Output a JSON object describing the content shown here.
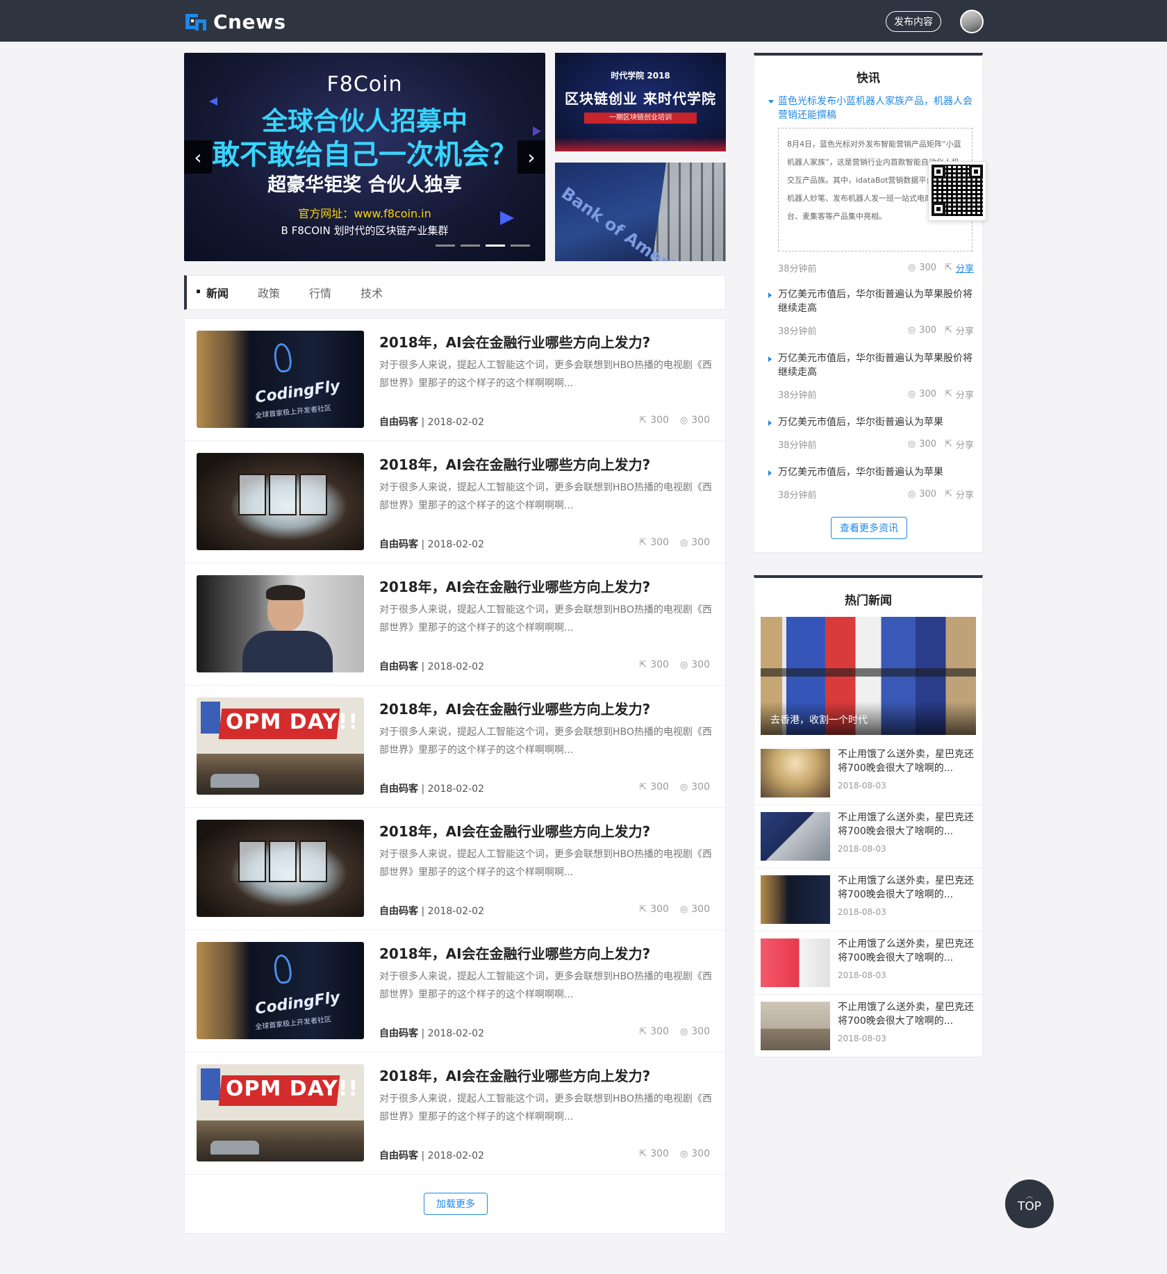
{
  "header": {
    "logo_text": "Cnews",
    "publish_label": "发布内容"
  },
  "banner": {
    "main": {
      "line1": "F8Coin",
      "line2": "全球合伙人招募中",
      "line3": "敢不敢给自己一次机会？",
      "line4": "超豪华钜奖   合伙人独享",
      "line5": "官方网址：www.f8coin.in",
      "line6": "B F8COIN 划时代的区块链产业集群",
      "prev": "‹",
      "next": "›",
      "dots": 4,
      "active_dot": 3
    },
    "side1": {
      "top": "时代学院 2018",
      "title": "区块链创业  来时代学院",
      "tag": "一期区块链创业培训"
    },
    "side2": {
      "sign": "Bank of America"
    }
  },
  "tabs": [
    "新闻",
    "政策",
    "行情",
    "技术"
  ],
  "news": [
    {
      "title": "2018年，AI会在金融行业哪些方向上发力?",
      "desc": "对于很多人来说，提起人工智能这个词，更多会联想到HBO热播的电视剧《西部世界》里那子的这个样子的这个样啊啊啊...",
      "author": "自由码客",
      "date": "2018-02-02",
      "shares": "300",
      "views": "300",
      "thumb": "coding",
      "thumb_text": "CodingFly",
      "thumb_sub": "全球首家极上开发者社区"
    },
    {
      "title": "2018年，AI会在金融行业哪些方向上发力?",
      "desc": "对于很多人来说，提起人工智能这个词，更多会联想到HBO热播的电视剧《西部世界》里那子的这个样子的这个样啊啊啊...",
      "author": "自由码客",
      "date": "2018-02-02",
      "shares": "300",
      "views": "300",
      "thumb": "office"
    },
    {
      "title": "2018年，AI会在金融行业哪些方向上发力?",
      "desc": "对于很多人来说，提起人工智能这个词，更多会联想到HBO热播的电视剧《西部世界》里那子的这个样子的这个样啊啊啊...",
      "author": "自由码客",
      "date": "2018-02-02",
      "shares": "300",
      "views": "300",
      "thumb": "person"
    },
    {
      "title": "2018年，AI会在金融行业哪些方向上发力?",
      "desc": "对于很多人来说，提起人工智能这个词，更多会联想到HBO热播的电视剧《西部世界》里那子的这个样子的这个样啊啊啊...",
      "author": "自由码客",
      "date": "2018-02-02",
      "shares": "300",
      "views": "300",
      "thumb": "opm",
      "thumb_text": "OPM DAY!!"
    },
    {
      "title": "2018年，AI会在金融行业哪些方向上发力?",
      "desc": "对于很多人来说，提起人工智能这个词，更多会联想到HBO热播的电视剧《西部世界》里那子的这个样子的这个样啊啊啊...",
      "author": "自由码客",
      "date": "2018-02-02",
      "shares": "300",
      "views": "300",
      "thumb": "office"
    },
    {
      "title": "2018年，AI会在金融行业哪些方向上发力?",
      "desc": "对于很多人来说，提起人工智能这个词，更多会联想到HBO热播的电视剧《西部世界》里那子的这个样子的这个样啊啊啊...",
      "author": "自由码客",
      "date": "2018-02-02",
      "shares": "300",
      "views": "300",
      "thumb": "coding",
      "thumb_text": "CodingFly",
      "thumb_sub": "全球首家极上开发者社区"
    },
    {
      "title": "2018年，AI会在金融行业哪些方向上发力?",
      "desc": "对于很多人来说，提起人工智能这个词，更多会联想到HBO热播的电视剧《西部世界》里那子的这个样子的这个样啊啊啊...",
      "author": "自由码客",
      "date": "2018-02-02",
      "shares": "300",
      "views": "300",
      "thumb": "opm",
      "thumb_text": "OPM DAY!!"
    }
  ],
  "load_more": "加载更多",
  "flash": {
    "title": "快讯",
    "items": [
      {
        "title": "蓝色光标发布小蓝机器人家族产品，机器人会营销还能撰稿",
        "open": true,
        "detail": "8月4日，蓝色光标对外发布智能营销产品矩阵“小蓝机器人家族”，这是营销行业内首款智能自动化人机交互产品族。其中，idataBot营销数据平台、撰稿机器人妙笔、发布机器人发一班一站式电商营销平台、麦集客等产品集中亮相。",
        "time": "38分钟前",
        "views": "300",
        "share": "分享"
      },
      {
        "title": "万亿美元市值后，华尔街普遍认为苹果股价将继续走高",
        "time": "38分钟前",
        "views": "300",
        "share": "分享"
      },
      {
        "title": "万亿美元市值后，华尔街普遍认为苹果股价将继续走高",
        "time": "38分钟前",
        "views": "300",
        "share": "分享"
      },
      {
        "title": "万亿美元市值后，华尔街普遍认为苹果",
        "time": "38分钟前",
        "views": "300",
        "share": "分享"
      },
      {
        "title": "万亿美元市值后，华尔街普遍认为苹果",
        "time": "38分钟前",
        "views": "300",
        "share": "分享"
      }
    ],
    "view_more": "查看更多资讯"
  },
  "hot": {
    "title": "热门新闻",
    "feature_caption": "去香港，收割一个时代",
    "items": [
      {
        "title": "不止用饿了么送外卖，星巴克还将700晚会很大了啥啊的...",
        "date": "2018-08-03"
      },
      {
        "title": "不止用饿了么送外卖，星巴克还将700晚会很大了啥啊的...",
        "date": "2018-08-03"
      },
      {
        "title": "不止用饿了么送外卖，星巴克还将700晚会很大了啥啊的...",
        "date": "2018-08-03"
      },
      {
        "title": "不止用饿了么送外卖，星巴克还将700晚会很大了啥啊的...",
        "date": "2018-08-03"
      },
      {
        "title": "不止用饿了么送外卖，星巴克还将700晚会很大了啥啊的...",
        "date": "2018-08-03"
      }
    ]
  },
  "top_button": "TOP",
  "colors": {
    "header_bg": "#2e3440",
    "accent": "#1e88e5"
  }
}
